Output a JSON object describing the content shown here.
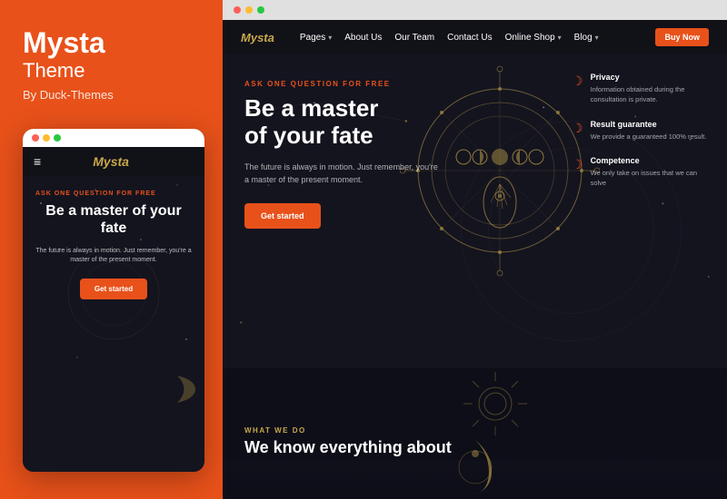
{
  "left": {
    "brand": {
      "name": "Mysta",
      "subtitle": "Theme",
      "by": "By Duck-Themes"
    },
    "mobile": {
      "browser_dots": [
        "red",
        "yellow",
        "green"
      ],
      "logo": "Mysta",
      "hamburger": "≡",
      "ask_label": "ASK ONE QUESTION FOR FREE",
      "heading": "Be a master of your fate",
      "desc": "The future is always in motion. Just remember, you're a master of the present moment.",
      "cta": "Get started"
    }
  },
  "right": {
    "browser_dots": [
      "red",
      "yellow",
      "green"
    ],
    "nav": {
      "logo": "Mysta",
      "links": [
        {
          "label": "Pages",
          "has_chevron": true
        },
        {
          "label": "About Us",
          "has_chevron": false
        },
        {
          "label": "Our Team",
          "has_chevron": false
        },
        {
          "label": "Contact Us",
          "has_chevron": false
        },
        {
          "label": "Online Shop",
          "has_chevron": true
        },
        {
          "label": "Blog",
          "has_chevron": true
        }
      ],
      "buy_btn": "Buy Now"
    },
    "hero": {
      "ask_label": "ASK ONE QUESTION FOR FREE",
      "heading_line1": "Be a master",
      "heading_line2": "of your fate",
      "desc": "The future is always in motion. Just remember, you're a master of the present moment.",
      "cta": "Get started"
    },
    "features": [
      {
        "icon": "🌙",
        "title": "Privacy",
        "desc": "Information obtained during the consultation is private."
      },
      {
        "icon": "🌙",
        "title": "Result guarantee",
        "desc": "We provide a guaranteed 100% result."
      },
      {
        "icon": "🌙",
        "title": "Competence",
        "desc": "We only take on issues that we can solve"
      }
    ],
    "bottom": {
      "label": "WHAT WE DO",
      "heading": "We know everything about"
    }
  },
  "colors": {
    "accent": "#e8511a",
    "gold": "#c8a84b",
    "dark_bg": "#14141f",
    "nav_bg": "#111118",
    "white": "#ffffff"
  }
}
